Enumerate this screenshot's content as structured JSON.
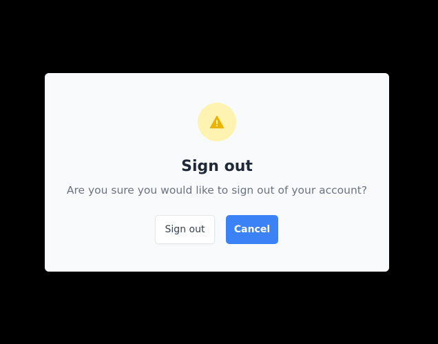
{
  "dialog": {
    "icon": "warning-triangle-icon",
    "icon_color": "#eab308",
    "icon_bg_color": "#fef3b0",
    "title": "Sign out",
    "message": "Are you sure you would like to sign out of your account?",
    "confirm_label": "Sign out",
    "cancel_label": "Cancel",
    "primary_color": "#3b82f6"
  }
}
